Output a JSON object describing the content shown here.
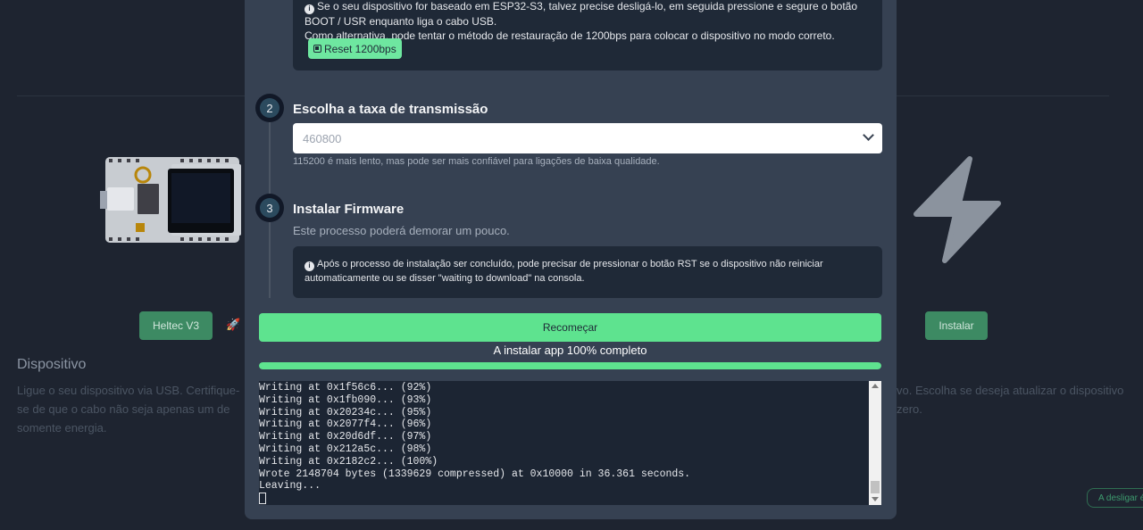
{
  "background": {
    "device_button": "Heltec V3",
    "install_button": "Instalar",
    "section_title": "Dispositivo",
    "section_desc": "Ligue o seu dispositivo via USB. Certifique-se de que o cabo não seja apenas um de somente energia.",
    "right_desc": "vo. Escolha se deseja atualizar o dispositivo zero.",
    "disconnect_label": "A desligar é",
    "icons": {
      "rocket": "rocket-icon",
      "bolt": "lightning-bolt-icon",
      "board": "heltec-board-image"
    }
  },
  "modal": {
    "top_info": {
      "line1": "Se o seu dispositivo for baseado em ESP32-S3, talvez precise desligá-lo, em seguida pressione e segure o botão BOOT / USR enquanto liga o cabo USB.",
      "line2": "Como alternativa, pode tentar o método de restauração de 1200bps para colocar o dispositivo no modo correto.",
      "reset_button": "Reset 1200bps"
    },
    "step2": {
      "number": "2",
      "title": "Escolha a taxa de transmissão",
      "selected_baud": "460800",
      "hint": "115200 é mais lento, mas pode ser mais confiável para ligações de baixa qualidade."
    },
    "step3": {
      "number": "3",
      "title": "Instalar Firmware",
      "subtitle": "Este processo poderá demorar um pouco.",
      "info": "Após o processo de instalação ser concluído, pode precisar de pressionar o botão RST se o dispositivo não reiniciar automaticamente ou se disser \"waiting to download\" na consola."
    },
    "restart_button": "Recomeçar",
    "progress_label": "A instalar app 100% completo",
    "progress": 1.0,
    "console_lines": [
      "Writing at 0x1f56c6... (92%)",
      "Writing at 0x1fb090... (93%)",
      "Writing at 0x20234c... (95%)",
      "Writing at 0x2077f4... (96%)",
      "Writing at 0x20d6df... (97%)",
      "Writing at 0x212a5c... (98%)",
      "Writing at 0x2182c2... (100%)",
      "Wrote 2148704 bytes (1339629 compressed) at 0x10000 in 36.361 seconds.",
      "Leaving..."
    ]
  },
  "colors": {
    "accent": "#5ee38f",
    "modal_bg": "#364152",
    "panel_bg": "#1f2937",
    "page_bg": "#1e2430"
  }
}
